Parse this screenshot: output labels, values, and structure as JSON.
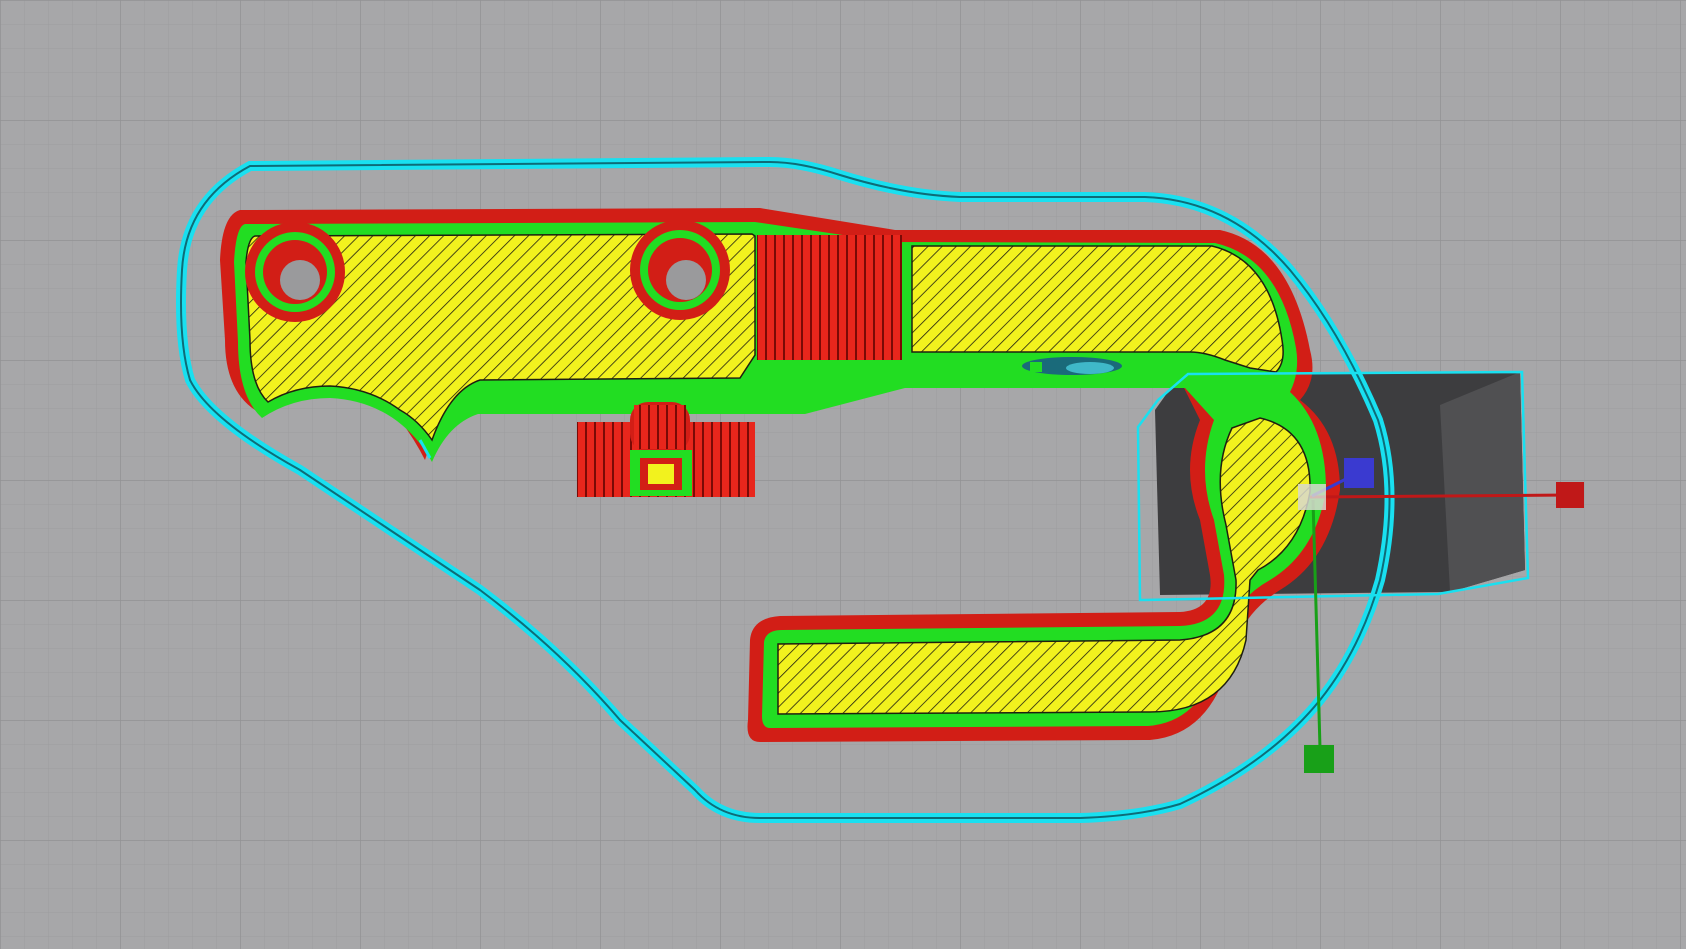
{
  "app": {
    "view": "layer-preview",
    "tool": "move-gizmo"
  },
  "colors": {
    "background": "#a7a7a9",
    "grid_minor": "#9d9d9f",
    "grid_major": "#939395",
    "skirt": "#19e0f0",
    "outer_wall": "#e8261c",
    "inner_wall": "#22dd22",
    "infill": "#f2f21e",
    "travel_dark": "#1a6a7a",
    "shadow": "#3a3a3c",
    "axis_x": "#c01818",
    "axis_y": "#18a018",
    "axis_z": "#3a3ad0"
  },
  "icons": {
    "gizmo_x": "move-x-handle-icon",
    "gizmo_y": "move-y-handle-icon",
    "gizmo_z": "move-z-handle-icon",
    "gizmo_origin": "gizmo-origin-icon"
  }
}
